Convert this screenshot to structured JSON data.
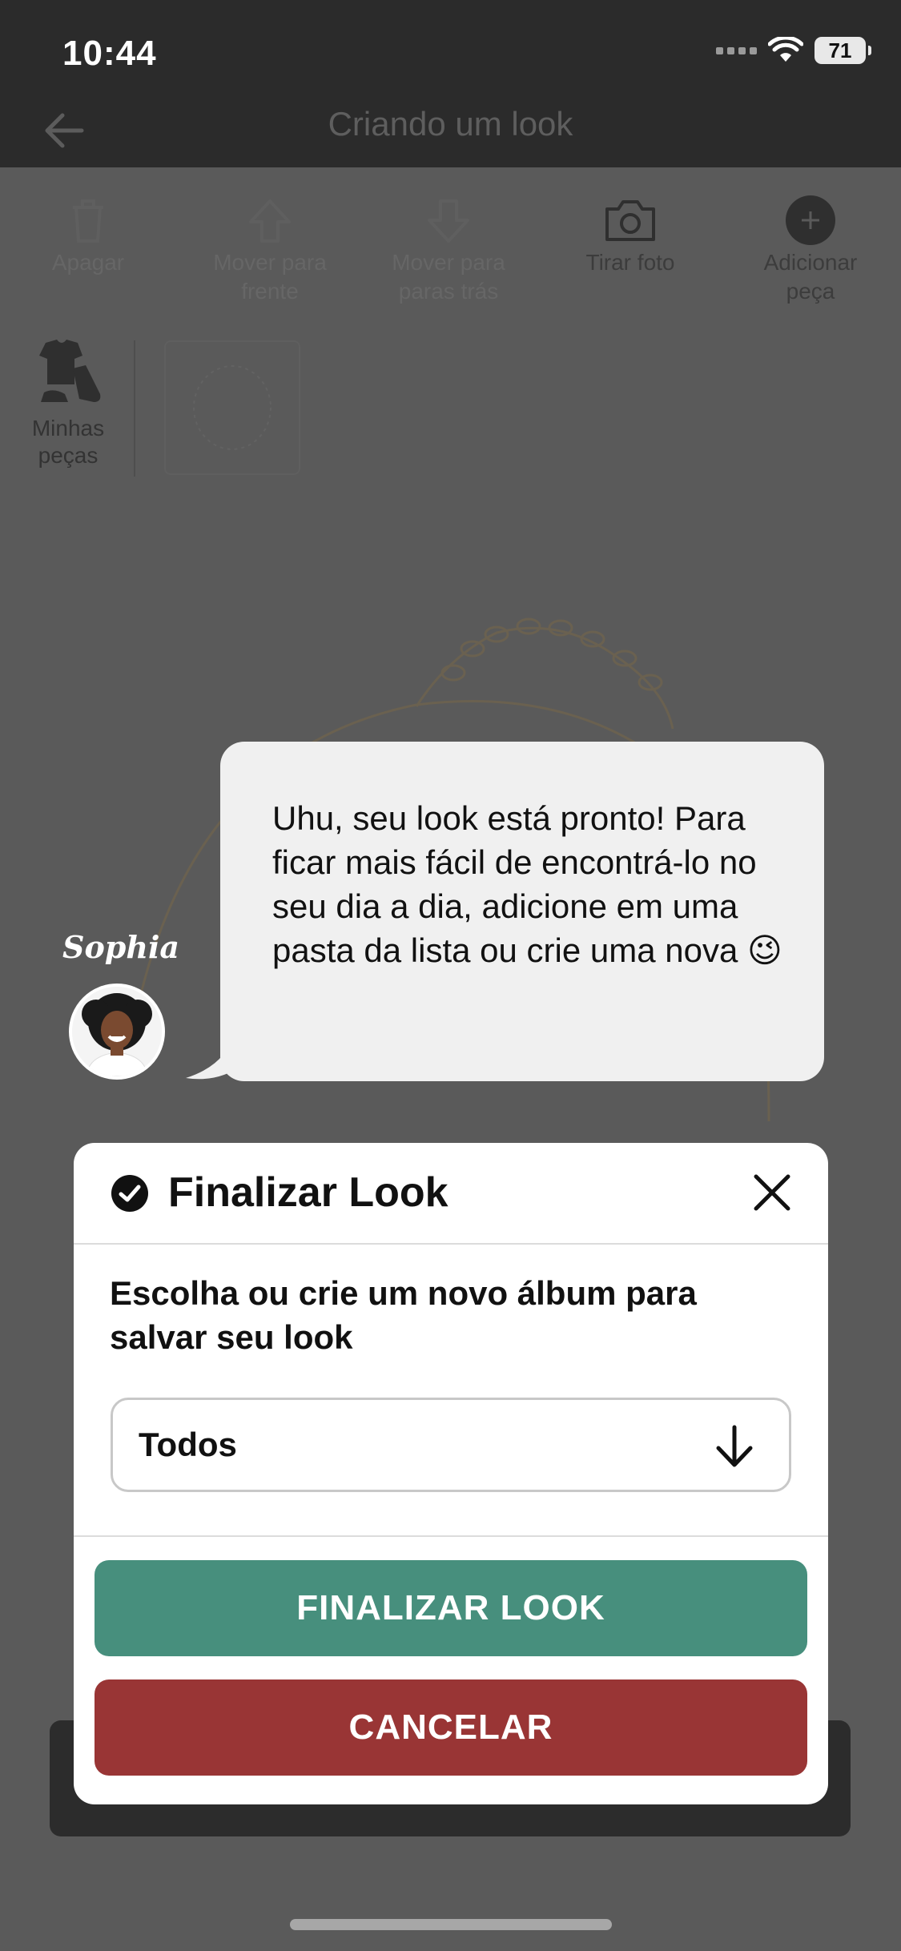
{
  "status_bar": {
    "time": "10:44",
    "battery": "71"
  },
  "header": {
    "title": "Criando um look"
  },
  "toolbar": {
    "items": [
      {
        "label": "Apagar",
        "icon": "trash-icon"
      },
      {
        "label": "Mover para\nfrente",
        "icon": "arrow-up-icon"
      },
      {
        "label": "Mover para\nparas trás",
        "icon": "arrow-down-icon"
      },
      {
        "label": "Tirar foto",
        "icon": "camera-icon"
      },
      {
        "label": "Adicionar\npeça",
        "icon": "plus-circle-icon"
      }
    ]
  },
  "pieces": {
    "label": "Minhas peças"
  },
  "assistant": {
    "name": "Sophia",
    "message": "Uhu, seu look está pronto! Para ficar mais fácil de encontrá-lo no seu dia a dia, adicione em uma pasta da lista ou crie uma nova 😉"
  },
  "modal": {
    "title": "Finalizar Look",
    "subtitle": "Escolha ou crie um novo álbum para salvar seu look",
    "album_select": {
      "value": "Todos"
    },
    "finalize_label": "FINALIZAR LOOK",
    "cancel_label": "CANCELAR"
  },
  "colors": {
    "finalize": "#478f7d",
    "cancel": "#993535",
    "overlay": "#5a5a5a"
  }
}
